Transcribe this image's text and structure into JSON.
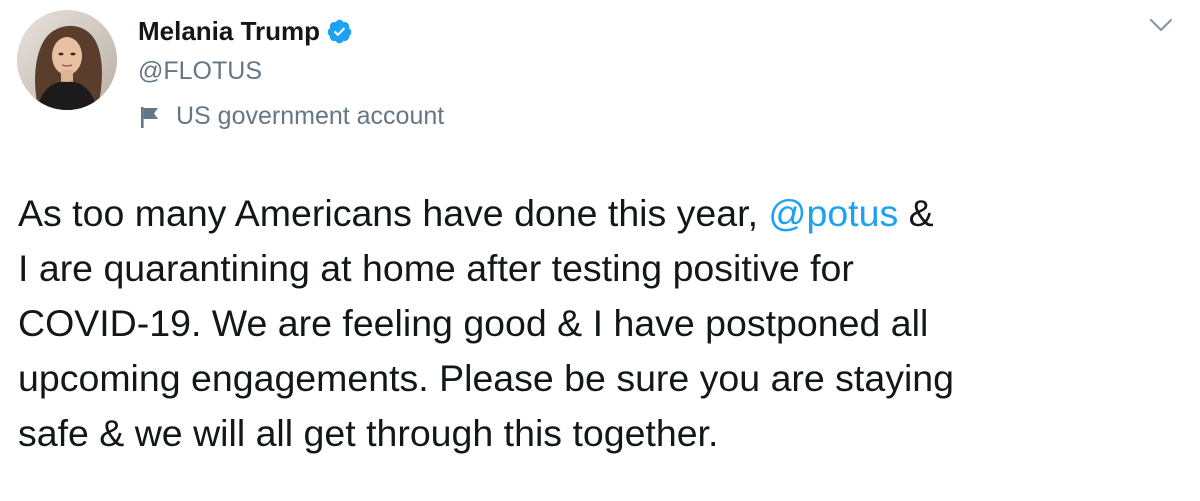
{
  "user": {
    "display_name": "Melania Trump",
    "handle": "@FLOTUS",
    "verified": true,
    "label": "US government account"
  },
  "icons": {
    "verified": "verified-badge-icon",
    "label": "flag-icon",
    "menu": "chevron-down-icon"
  },
  "tweet": {
    "text_part1": "As too many Americans have done this year, ",
    "mention": "@potus",
    "text_part2": " &\nI are quarantining at home after testing positive for\nCOVID-19. We are feeling good & I have postponed all\nupcoming engagements. Please be sure you are staying\nsafe & we will all get through this together."
  },
  "colors": {
    "text": "#14171a",
    "secondary": "#657786",
    "link": "#1da1f2",
    "verified": "#1da1f2"
  }
}
